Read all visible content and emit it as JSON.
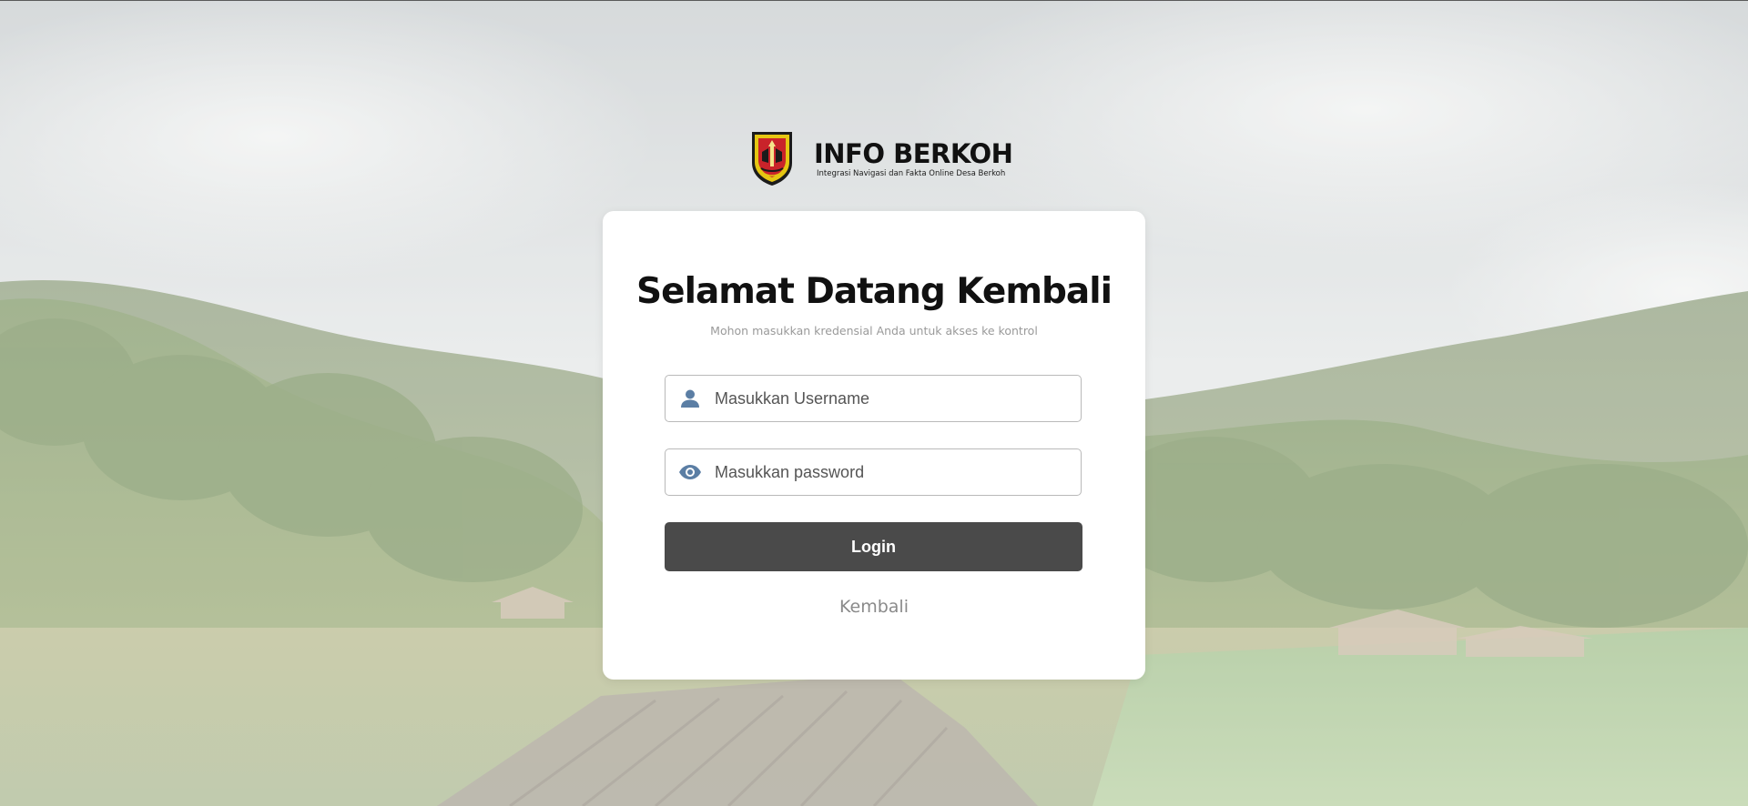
{
  "brand": {
    "title": "INFO BERKOH",
    "subtitle": "Integrasi Navigasi dan Fakta Online Desa Berkoh",
    "logo_icon": "regency-coat-of-arms"
  },
  "login": {
    "title": "Selamat Datang Kembali",
    "subtitle": "Mohon masukkan kredensial Anda untuk akses ke kontrol",
    "username": {
      "placeholder": "Masukkan Username",
      "value": "",
      "icon": "user-icon"
    },
    "password": {
      "placeholder": "Masukkan password",
      "value": "",
      "icon": "eye-icon"
    },
    "submit_label": "Login",
    "back_label": "Kembali"
  },
  "colors": {
    "button": "#4a4a4a",
    "icon": "#5b7ea4",
    "card": "#ffffff",
    "muted_text": "#9a9a9a"
  }
}
